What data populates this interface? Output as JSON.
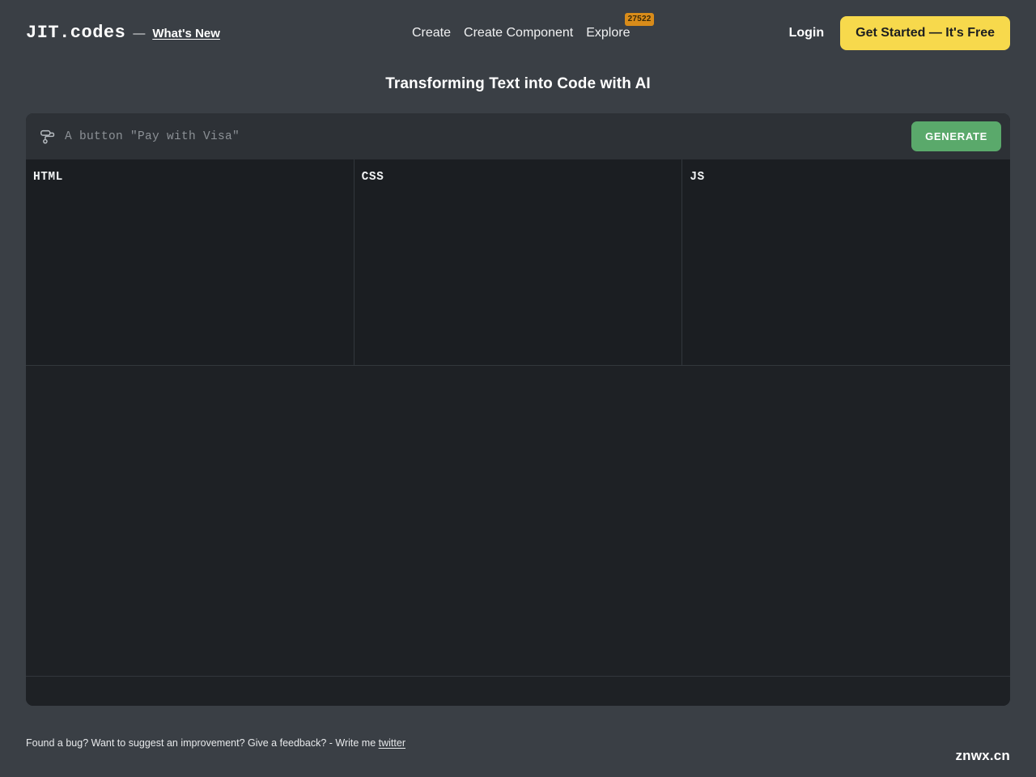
{
  "brand": {
    "logo": "JIT.codes",
    "separator": "—",
    "whats_new": "What's New"
  },
  "nav": {
    "items": [
      {
        "label": "Create",
        "badge": null
      },
      {
        "label": "Create Component",
        "badge": null
      },
      {
        "label": "Explore",
        "badge": "27522"
      }
    ],
    "login_label": "Login",
    "cta_label": "Get Started — It's Free"
  },
  "page": {
    "title": "Transforming Text into Code with AI"
  },
  "prompt": {
    "icon": "paint-roller-icon",
    "placeholder": "A button \"Pay with Visa\"",
    "value": "",
    "generate_label": "GENERATE"
  },
  "editors": [
    {
      "label": "HTML",
      "code": ""
    },
    {
      "label": "CSS",
      "code": ""
    },
    {
      "label": "JS",
      "code": ""
    }
  ],
  "footer": {
    "text": "Found a bug? Want to suggest an improvement? Give a feedback? - Write me ",
    "link_label": "twitter",
    "watermark": "znwx.cn"
  },
  "colors": {
    "page_background": "#3a3f45",
    "card_background": "#1e2124",
    "prompt_background": "#2d3136",
    "editor_background": "#1b1e22",
    "divider": "#32373c",
    "cta_yellow": "#f7d94c",
    "generate_green": "#5aa96b",
    "badge_orange": "#d98c1a"
  }
}
